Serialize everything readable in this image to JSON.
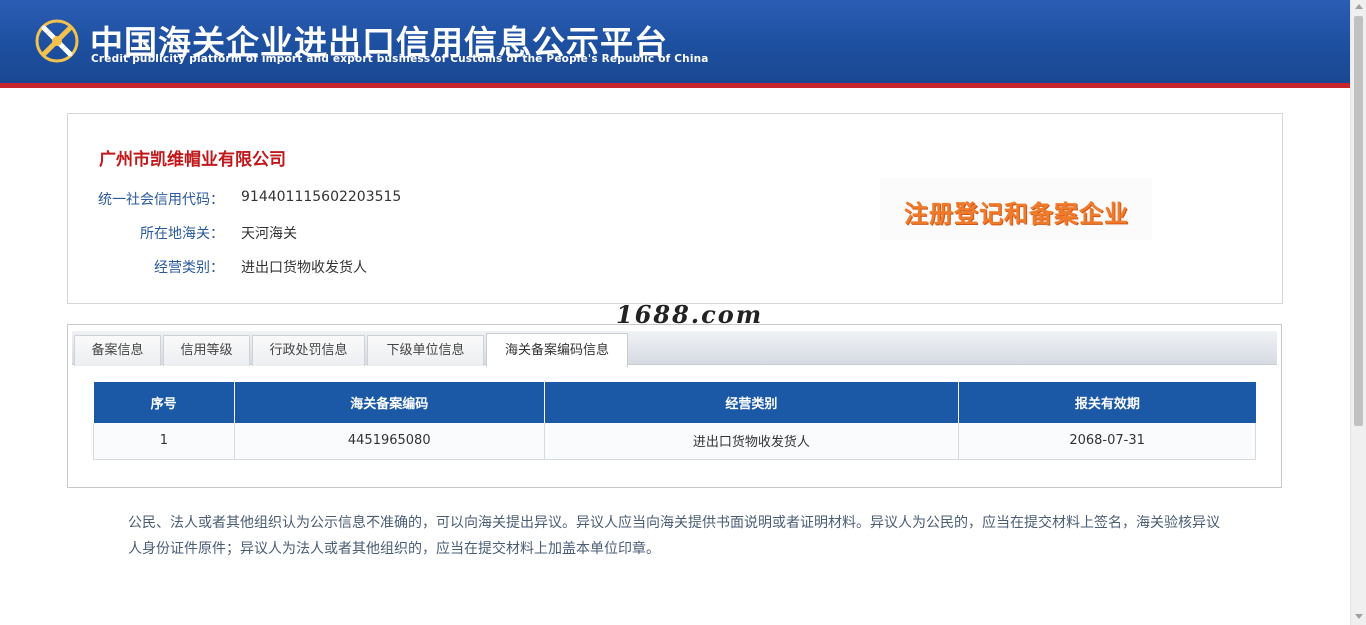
{
  "header": {
    "title_cn": "中国海关企业进出口信用信息公示平台",
    "title_en": "Credit publicity platform of import and export business of Customs of the People's Republic of China"
  },
  "company": {
    "name": "广州市凯维帽业有限公司",
    "fields": [
      {
        "label": "统一社会信用代码：",
        "value": "914401115602203515"
      },
      {
        "label": "所在地海关：",
        "value": "天河海关"
      },
      {
        "label": "经营类别：",
        "value": "进出口货物收发货人"
      }
    ],
    "stamp": "注册登记和备案企业"
  },
  "watermark": "1688.com",
  "tabs": [
    {
      "label": "备案信息",
      "active": false
    },
    {
      "label": "信用等级",
      "active": false
    },
    {
      "label": "行政处罚信息",
      "active": false
    },
    {
      "label": "下级单位信息",
      "active": false
    },
    {
      "label": "海关备案编码信息",
      "active": true
    }
  ],
  "table": {
    "headers": [
      "序号",
      "海关备案编码",
      "经营类别",
      "报关有效期"
    ],
    "rows": [
      [
        "1",
        "4451965080",
        "进出口货物收发货人",
        "2068-07-31"
      ]
    ]
  },
  "notice": "公民、法人或者其他组织认为公示信息不准确的，可以向海关提出异议。异议人应当向海关提供书面说明或者证明材料。异议人为公民的，应当在提交材料上签名，海关验核异议人身份证件原件；异议人为法人或者其他组织的，应当在提交材料上加盖本单位印章。",
  "colors": {
    "header_blue": "#1d4f9f",
    "header_red_stripe": "#c9242a",
    "company_name_red": "#c0181b",
    "label_blue": "#2a5a9c",
    "stamp_orange": "#f07b2a",
    "table_header_blue": "#1b59a6"
  }
}
